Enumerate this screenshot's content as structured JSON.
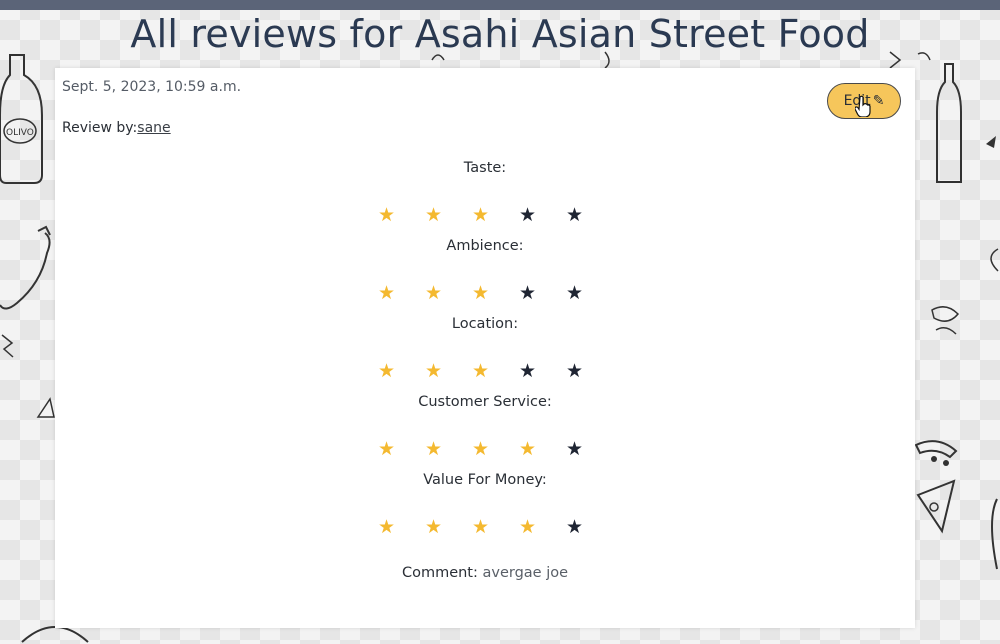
{
  "page": {
    "title": "All reviews for Asahi Asian Street Food"
  },
  "review": {
    "timestamp": "Sept. 5, 2023, 10:59 a.m.",
    "review_by_label": "Review by:",
    "reviewer": "sane",
    "edit_label": "Edit",
    "comment_label": "Comment:",
    "comment_text": "avergae joe",
    "ratings": [
      {
        "label": "Taste:",
        "score": 3,
        "max": 5
      },
      {
        "label": "Ambience:",
        "score": 3,
        "max": 5
      },
      {
        "label": "Location:",
        "score": 3,
        "max": 5
      },
      {
        "label": "Customer Service:",
        "score": 4,
        "max": 5
      },
      {
        "label": "Value For Money:",
        "score": 4,
        "max": 5
      }
    ]
  },
  "colors": {
    "star_filled": "#f4b930",
    "star_empty": "#1f2533",
    "edit_button": "#f6c65b",
    "title": "#2b3a52"
  },
  "icons": {
    "star": "star-icon",
    "edit": "pencil-icon",
    "cursor": "hand-pointer-icon"
  }
}
